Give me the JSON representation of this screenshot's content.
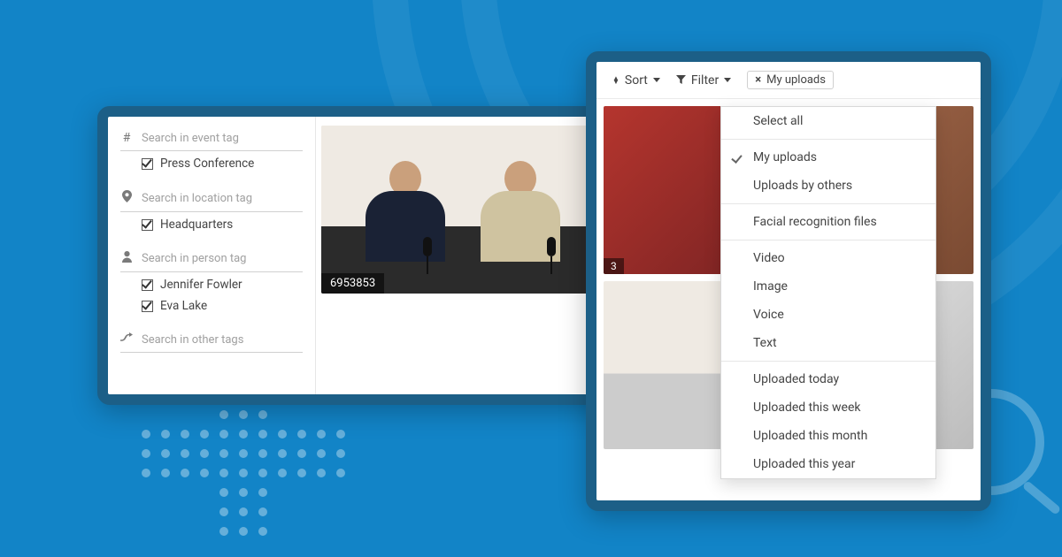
{
  "leftPanel": {
    "searches": {
      "event": {
        "placeholder": "Search in event tag",
        "tags": [
          "Press Conference"
        ]
      },
      "location": {
        "placeholder": "Search in location tag",
        "tags": [
          "Headquarters"
        ]
      },
      "person": {
        "placeholder": "Search in person tag",
        "tags": [
          "Jennifer Fowler",
          "Eva Lake"
        ]
      },
      "other": {
        "placeholder": "Search in other tags",
        "tags": []
      }
    },
    "thumbnail": {
      "id": "6953853"
    }
  },
  "rightPanel": {
    "toolbar": {
      "sort": "Sort",
      "filter": "Filter",
      "chip": {
        "label": "My uploads"
      }
    },
    "dropdown": {
      "selectAll": "Select all",
      "groups": [
        [
          "My uploads",
          "Uploads by others"
        ],
        [
          "Facial recognition files"
        ],
        [
          "Video",
          "Image",
          "Voice",
          "Text"
        ],
        [
          "Uploaded today",
          "Uploaded this week",
          "Uploaded this month",
          "Uploaded this year"
        ]
      ],
      "checkedItems": [
        "My uploads"
      ]
    },
    "gridId": "3"
  }
}
